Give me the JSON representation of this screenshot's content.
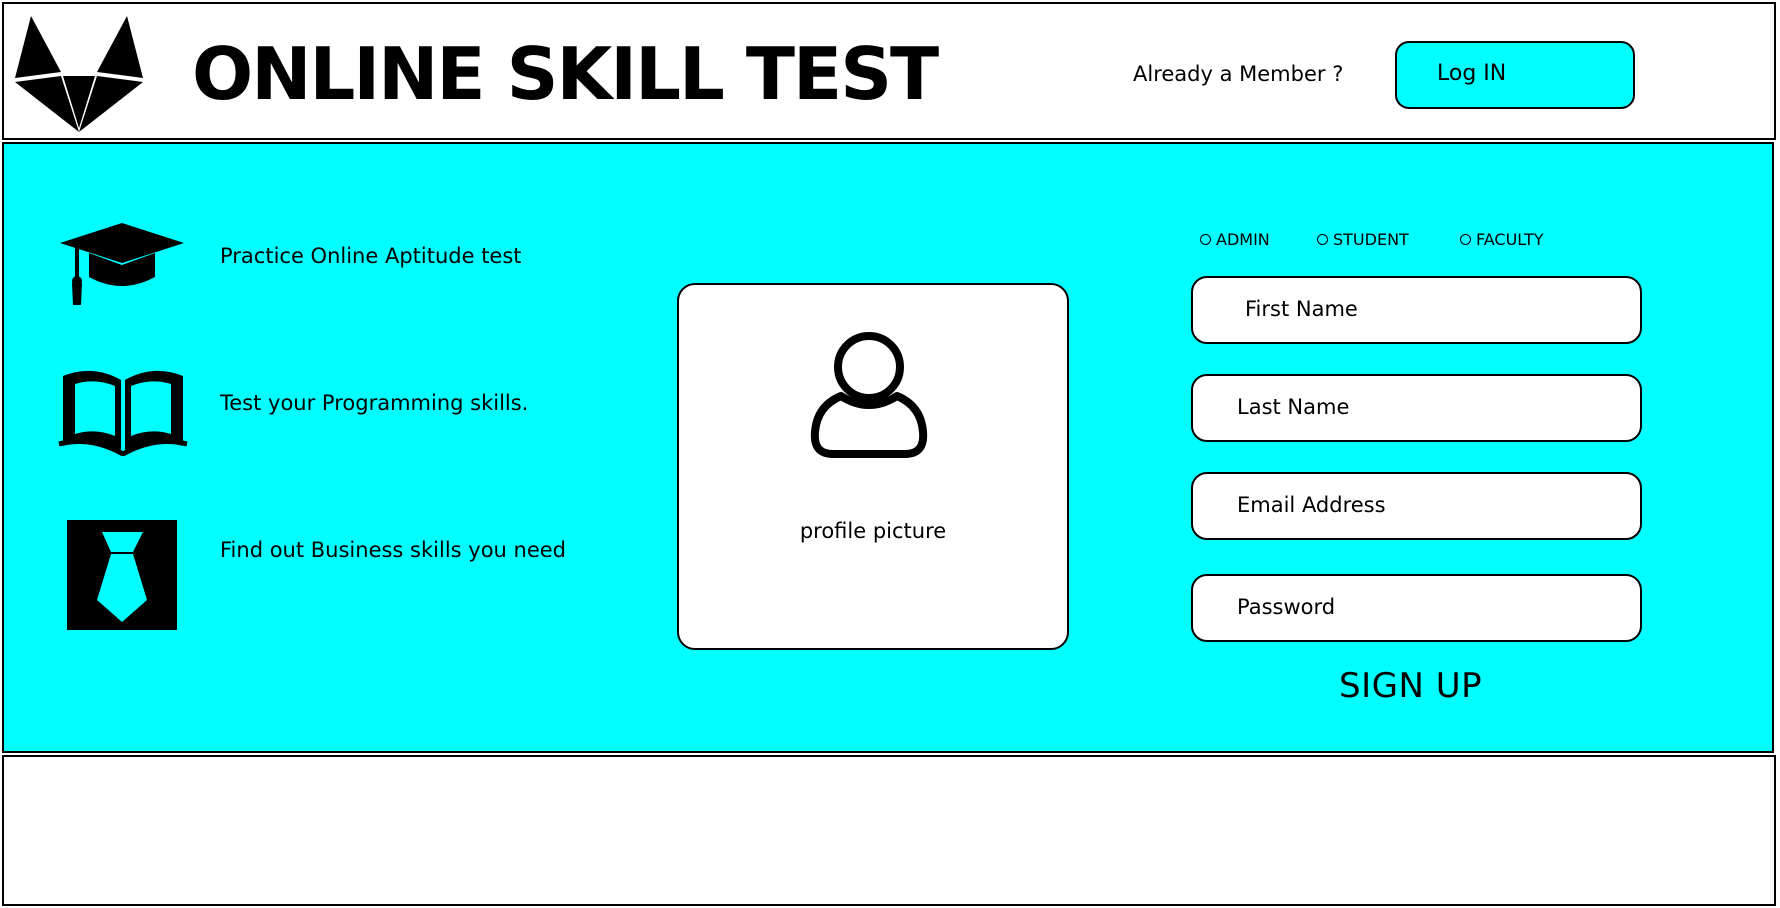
{
  "header": {
    "title": "ONLINE SKILL TEST",
    "member_prompt": "Already a Member ?",
    "login_label": "Log IN"
  },
  "features": [
    {
      "icon": "graduation-cap-icon",
      "text": "Practice Online Aptitude test"
    },
    {
      "icon": "open-book-icon",
      "text": "Test your Programming skills."
    },
    {
      "icon": "necktie-icon",
      "text": "Find out Business skills you need"
    }
  ],
  "profile": {
    "icon": "user-icon",
    "caption": "profile picture"
  },
  "signup_form": {
    "roles": [
      "ADMIN",
      "STUDENT",
      "FACULTY"
    ],
    "fields": {
      "first_name": "First Name",
      "last_name": "Last Name",
      "email": "Email Address",
      "password": "Password"
    },
    "submit_label": "SIGN UP"
  },
  "colors": {
    "accent": "#00ffff",
    "border": "#000000",
    "background": "#ffffff"
  }
}
